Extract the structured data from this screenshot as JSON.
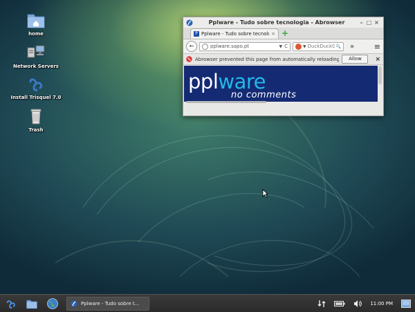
{
  "desktop": {
    "icons": [
      {
        "label": "home",
        "icon": "folder-home-icon"
      },
      {
        "label": "Network Servers",
        "icon": "network-servers-icon"
      },
      {
        "label": "Install Trisquel 7.0",
        "icon": "trisquel-installer-icon"
      },
      {
        "label": "Trash",
        "icon": "trash-icon"
      }
    ]
  },
  "window": {
    "title": "Pplware - Tudo sobre tecnologia - Abrowser",
    "controls": {
      "minimize": "–",
      "maximize": "□",
      "close": "×"
    },
    "tab": {
      "label": "Pplware - Tudo sobre tecnolo",
      "close": "×"
    },
    "new_tab": "+",
    "nav": {
      "back": "←",
      "url": "pplware.sapo.pt",
      "reload": "C",
      "dropdown": "▼",
      "search_placeholder": "DuckDuckGo (SS",
      "search_go": "🔍",
      "overflow": "»",
      "menu": "≡"
    },
    "infobar": {
      "message": "Abrowser prevented this page from automatically reloading.",
      "allow_label": "Allow",
      "close": "×"
    },
    "page": {
      "logo_left": "ppl",
      "logo_right": "ware",
      "tagline": "no comments"
    }
  },
  "taskbar": {
    "task_label": "Pplware - Tudo sobre t...",
    "clock": "11:00 PM",
    "colors": {
      "accent": "#22b8e8",
      "banner": "#142a73"
    }
  }
}
